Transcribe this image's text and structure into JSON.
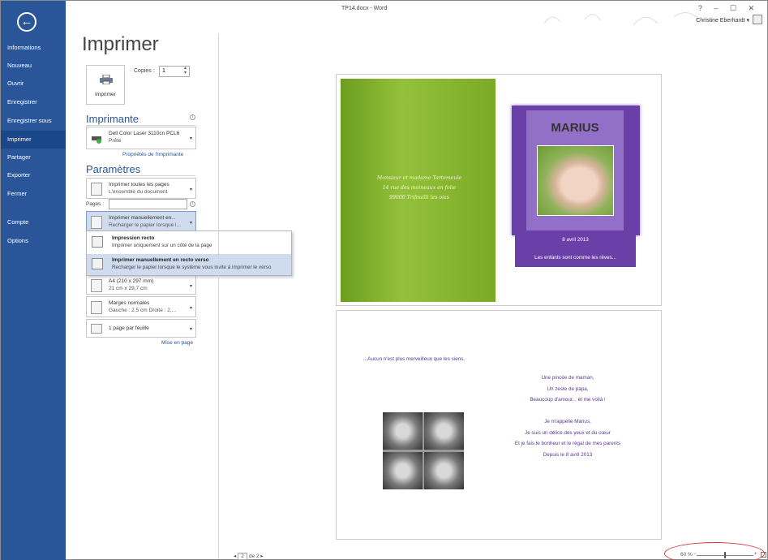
{
  "window": {
    "title": "TP14.docx - Word",
    "controls": "? – ☐ ✕",
    "user": "Christine Eberhardt ▾"
  },
  "nav": {
    "items": [
      "Informations",
      "Nouveau",
      "Ouvrir",
      "Enregistrer",
      "Enregistrer sous",
      "Imprimer",
      "Partager",
      "Exporter",
      "Fermer",
      "Compte",
      "Options"
    ]
  },
  "print": {
    "heading": "Imprimer",
    "button_label": "Imprimer",
    "copies_label": "Copies :",
    "copies_value": "1"
  },
  "printer": {
    "section_title": "Imprimante",
    "name": "Dell Color Laser 3110cn PCL6",
    "status": "Prête",
    "properties_link": "Propriétés de l'imprimante"
  },
  "settings": {
    "section_title": "Paramètres",
    "pages_scope_title": "Imprimer toutes les pages",
    "pages_scope_desc": "L'ensemble du document",
    "pages_label": "Pages :",
    "duplex_title": "Imprimer manuellement en...",
    "duplex_desc": "Recharger le papier lorsque l...",
    "paper_title": "A4 (210 x 297 mm)",
    "paper_desc": "21 cm x 29,7 cm",
    "margins_title": "Marges normales",
    "margins_desc": "Gauche : 2,5 cm   Droite : 2,...",
    "persheet_title": "1 page par feuille",
    "layout_link": "Mise en page"
  },
  "duplex_menu": [
    {
      "title": "Impression recto",
      "desc": "Imprimer uniquement sur un côté de la page"
    },
    {
      "title": "Imprimer manuellement en recto verso",
      "desc": "Recharger le papier lorsque le système vous invite à imprimer le verso"
    }
  ],
  "preview": {
    "green_text": [
      "Monsieur et madame Tartemeule",
      "14 rue des moineaux en folie",
      "99000 Trifouilli les oies"
    ],
    "card_name": "MARIUS",
    "band_date": "8 avril 2013",
    "band_text": "Les enfants sont comme les rêves...",
    "intro": "...Aucun n'est plus merveilleux que les siens.",
    "poem": [
      "Une pincée de maman,",
      "Un zeste de papa,",
      "Beaucoup d'amour... et me voilà !",
      "",
      "Je m'appelle Marius,",
      "Je suis un délice des yeux et du cœur",
      "Et je fais le bonheur et le régal de mes parents",
      "Depuis le 8 avril 2013"
    ]
  },
  "footer": {
    "page_prev": "◂",
    "page_current": "2",
    "page_total": "de 2",
    "page_next": "▸",
    "zoom": "60 %"
  }
}
